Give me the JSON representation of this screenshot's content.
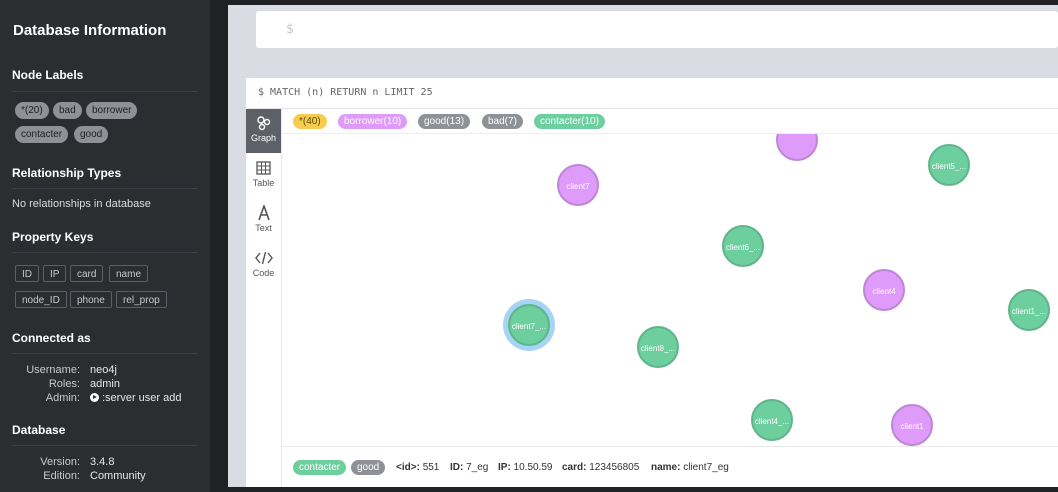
{
  "sidebar": {
    "title": "Database Information",
    "node_labels": {
      "heading": "Node Labels",
      "items": [
        "*(20)",
        "bad",
        "borrower",
        "contacter",
        "good"
      ]
    },
    "relationship_types": {
      "heading": "Relationship Types",
      "empty": "No relationships in database"
    },
    "property_keys": {
      "heading": "Property Keys",
      "items": [
        "ID",
        "IP",
        "card",
        "name",
        "node_ID",
        "phone",
        "rel_prop"
      ]
    },
    "connected_as": {
      "heading": "Connected as",
      "username_label": "Username:",
      "username": "neo4j",
      "roles_label": "Roles:",
      "roles": "admin",
      "admin_label": "Admin:",
      "admin_cmd": ":server user add"
    },
    "database": {
      "heading": "Database",
      "version_label": "Version:",
      "version": "3.4.8",
      "edition_label": "Edition:",
      "edition": "Community"
    }
  },
  "editor": {
    "prompt": "$"
  },
  "result": {
    "query": "$ MATCH (n) RETURN n LIMIT 25",
    "tabs": [
      {
        "label": "Graph",
        "icon": "graph-icon"
      },
      {
        "label": "Table",
        "icon": "table-icon"
      },
      {
        "label": "Text",
        "icon": "text-icon"
      },
      {
        "label": "Code",
        "icon": "code-icon"
      }
    ],
    "legend": [
      {
        "label": "*(40)",
        "color": "#f7cb4d"
      },
      {
        "label": "borrower(10)",
        "color": "#de9bf9"
      },
      {
        "label": "good(13)",
        "color": "#8e9196"
      },
      {
        "label": "bad(7)",
        "color": "#8e9196"
      },
      {
        "label": "contacter(10)",
        "color": "#6dce9e"
      }
    ],
    "nodes": [
      {
        "caption": "",
        "color": "purple"
      },
      {
        "caption": "client5_...",
        "color": "green"
      },
      {
        "caption": "client7",
        "color": "purple"
      },
      {
        "caption": "client6_...",
        "color": "green"
      },
      {
        "caption": "client4",
        "color": "purple"
      },
      {
        "caption": "client1_...",
        "color": "green"
      },
      {
        "caption": "client7_...",
        "color": "green",
        "selected": true
      },
      {
        "caption": "client8_...",
        "color": "green"
      },
      {
        "caption": "client4_...",
        "color": "green"
      },
      {
        "caption": "client1",
        "color": "purple"
      }
    ],
    "status": {
      "labels": [
        "contacter",
        "good"
      ],
      "id_key": "<id>:",
      "id_val": "551",
      "ID_key": "ID:",
      "ID_val": "7_eg",
      "IP_key": "IP:",
      "IP_val": "10.50.59",
      "card_key": "card:",
      "card_val": "123456805",
      "name_key": "name:",
      "name_val": "client7_eg"
    }
  }
}
